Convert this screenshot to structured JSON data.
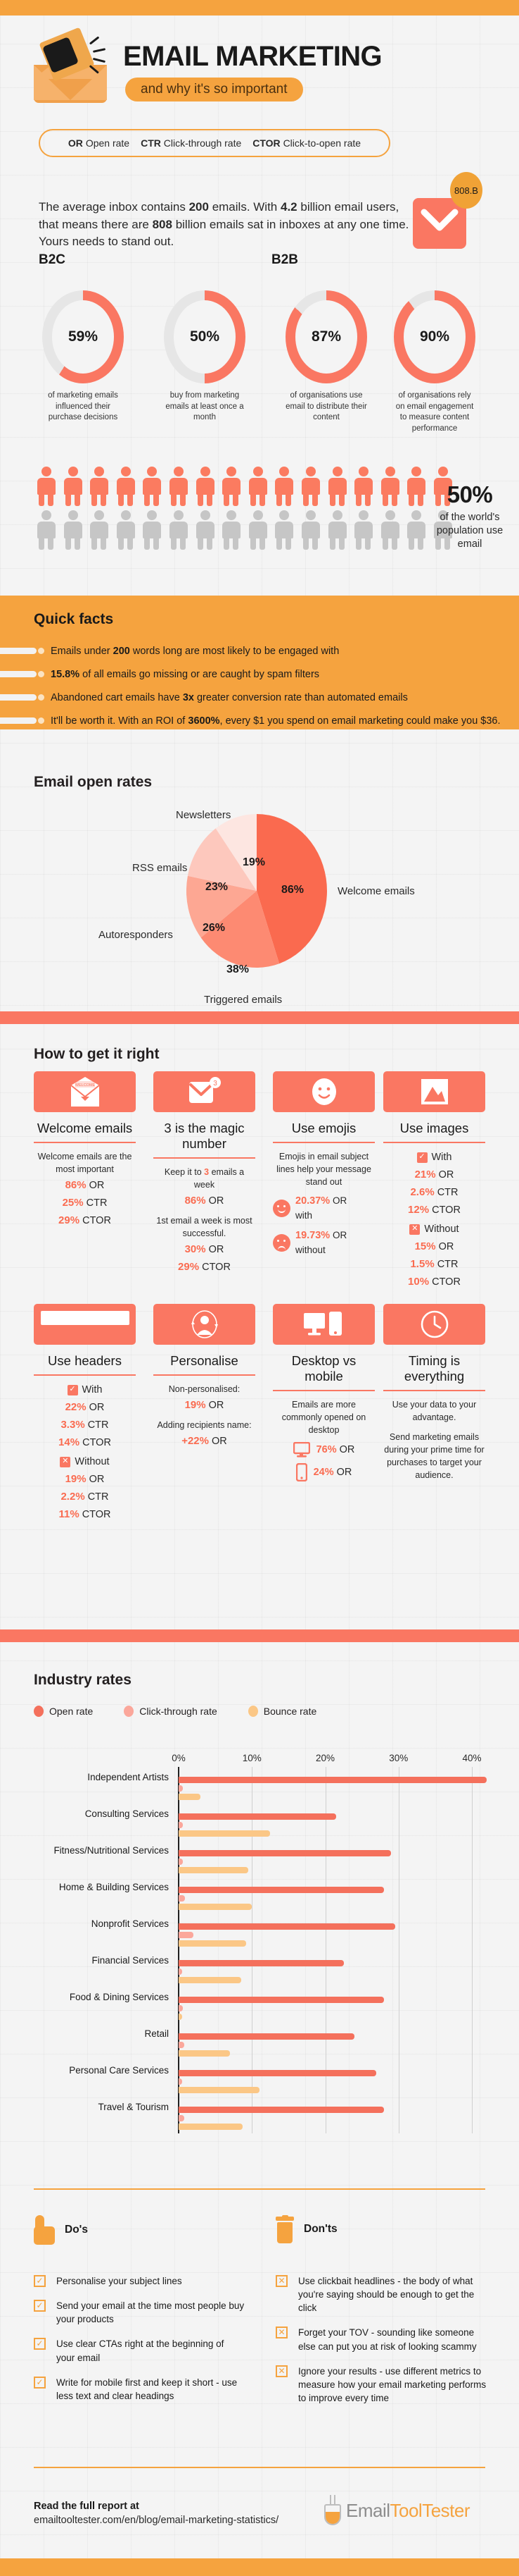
{
  "header": {
    "title": "EMAIL MARKETING",
    "subtitle": "and why it's so important",
    "logo_icon": "megaphone-envelope-icon"
  },
  "legend": [
    {
      "abbr": "OR",
      "full": "Open rate"
    },
    {
      "abbr": "CTR",
      "full": "Click-through rate"
    },
    {
      "abbr": "CTOR",
      "full": "Click-to-open rate"
    }
  ],
  "intro": {
    "part1": "The average inbox contains ",
    "n1": "200",
    "part2": " emails. With ",
    "n2": "4.2",
    "part3": " billion email users, that means there are ",
    "n3": "808",
    "part4": " billion emails sat in inboxes at any one time. Yours needs to stand out.",
    "badge": "808.B",
    "envelope_icon": "envelope-icon"
  },
  "segments": {
    "b2c_label": "B2C",
    "b2b_label": "B2B",
    "donuts": [
      {
        "value": "59%",
        "pct": 59,
        "caption": "of marketing emails influenced their purchase decisions"
      },
      {
        "value": "50%",
        "pct": 50,
        "caption": "buy from marketing emails at least once a month"
      },
      {
        "value": "87%",
        "pct": 87,
        "caption": "of organisations use email to distribute their content"
      },
      {
        "value": "90%",
        "pct": 90,
        "caption": "of organisations rely on email engagement to measure content performance"
      }
    ]
  },
  "population": {
    "stat": "50%",
    "caption": "of the world's population use email",
    "filled_icons": 16,
    "empty_icons": 16
  },
  "quick_facts": {
    "title": "Quick facts",
    "items": [
      {
        "pre": "Emails under ",
        "bold": "200",
        "post": " words long are most likely to be engaged with"
      },
      {
        "pre": "",
        "bold": "15.8%",
        "post": " of all emails go missing or are caught by spam filters"
      },
      {
        "pre": "Abandoned cart emails have ",
        "bold": "3x",
        "post": " greater conversion rate than automated emails"
      },
      {
        "pre": "It'll be worth it. With an ROI of ",
        "bold": "3600%",
        "post": ", every $1 you spend on email marketing could make you $36."
      }
    ]
  },
  "chart_data": [
    {
      "type": "pie",
      "title": "Email open rates",
      "labels": [
        "Welcome emails",
        "Triggered emails",
        "Autoresponders",
        "RSS emails",
        "Newsletters"
      ],
      "values": [
        86,
        38,
        26,
        23,
        19
      ],
      "value_labels": [
        "86%",
        "38%",
        "26%",
        "23%",
        "19%"
      ],
      "colors": [
        "#fa6a4f",
        "#fd8a72",
        "#fda793",
        "#fdc8bd",
        "#fde6e1"
      ],
      "legend": "inline-labels"
    },
    {
      "type": "bar",
      "orientation": "horizontal",
      "title": "Industry rates",
      "series": [
        {
          "name": "Open rate",
          "color": "#f4705c",
          "values": [
            42.0,
            21.5,
            29.0,
            28.0,
            29.5,
            22.5,
            28.0,
            24.0,
            27.0,
            28.0
          ]
        },
        {
          "name": "Click-through rate",
          "color": "#fba79b",
          "values": [
            0.6,
            0.6,
            0.6,
            0.9,
            2.0,
            0.5,
            0.6,
            0.8,
            0.5,
            0.8
          ]
        },
        {
          "name": "Bounce rate",
          "color": "#fbc786",
          "values": [
            3.0,
            12.5,
            9.5,
            10.0,
            9.2,
            8.5,
            0.5,
            7.0,
            11.0,
            8.7
          ]
        }
      ],
      "categories": [
        "Independent Artists",
        "Consulting Services",
        "Fitness/Nutritional Services",
        "Home & Building Services",
        "Nonprofit Services",
        "Financial Services",
        "Food & Dining Services",
        "Retail",
        "Personal Care Services",
        "Travel & Tourism"
      ],
      "xticks": [
        "0%",
        "10%",
        "20%",
        "30%",
        "40%"
      ],
      "xlim": [
        0,
        44
      ],
      "xlabel": "",
      "ylabel": "",
      "grid": true,
      "legend_position": "top-left"
    }
  ],
  "how_to": {
    "title": "How to get it right",
    "cards": [
      {
        "icon": "welcome-envelope-icon",
        "title": "Welcome emails",
        "body": "Welcome emails are the most important",
        "stats": [
          {
            "n": "86%",
            "k": "OR"
          },
          {
            "n": "25%",
            "k": "CTR"
          },
          {
            "n": "29%",
            "k": "CTOR"
          }
        ]
      },
      {
        "icon": "envelope-badge-3-icon",
        "title": "3 is the magic number",
        "body_pre": "Keep it to ",
        "body_num": "3",
        "body_post": " emails a week",
        "stats": [
          {
            "n": "86%",
            "k": "OR"
          }
        ],
        "note": "1st email a week is most successful.",
        "stats2": [
          {
            "n": "30%",
            "k": "OR"
          },
          {
            "n": "29%",
            "k": "CTOR"
          }
        ]
      },
      {
        "icon": "smiley-face-icon",
        "title": "Use emojis",
        "body": "Emojis in email subject lines help your message stand out",
        "emoji_stats": [
          {
            "face": "happy",
            "n": "20.37%",
            "k": "OR",
            "sub": "with"
          },
          {
            "face": "sad",
            "n": "19.73%",
            "k": "OR",
            "sub": "without"
          }
        ]
      },
      {
        "icon": "image-mountain-icon",
        "title": "Use images",
        "groups": [
          {
            "mark": "check",
            "label": "With",
            "stats": [
              {
                "n": "21%",
                "k": "OR"
              },
              {
                "n": "2.6%",
                "k": "CTR"
              },
              {
                "n": "12%",
                "k": "CTOR"
              }
            ]
          },
          {
            "mark": "cross",
            "label": "Without",
            "stats": [
              {
                "n": "15%",
                "k": "OR"
              },
              {
                "n": "1.5%",
                "k": "CTR"
              },
              {
                "n": "10%",
                "k": "CTOR"
              }
            ]
          }
        ]
      },
      {
        "icon": "header-bar-icon",
        "title": "Use headers",
        "groups": [
          {
            "mark": "check",
            "label": "With",
            "stats": [
              {
                "n": "22%",
                "k": "OR"
              },
              {
                "n": "3.3%",
                "k": "CTR"
              },
              {
                "n": "14%",
                "k": "CTOR"
              }
            ]
          },
          {
            "mark": "cross",
            "label": "Without",
            "stats": [
              {
                "n": "19%",
                "k": "OR"
              },
              {
                "n": "2.2%",
                "k": "CTR"
              },
              {
                "n": "11%",
                "k": "CTOR"
              }
            ]
          }
        ]
      },
      {
        "icon": "person-circle-icon",
        "title": "Personalise",
        "lines": [
          {
            "t": "Non-personalised:",
            "type": "text"
          },
          {
            "n": "19%",
            "k": "OR",
            "type": "stat"
          },
          {
            "t": "Adding recipients name:",
            "type": "text"
          },
          {
            "n": "+22%",
            "k": "OR",
            "type": "stat"
          }
        ]
      },
      {
        "icon": "desktop-mobile-icon",
        "title": "Desktop vs mobile",
        "body": "Emails are more commonly opened on desktop",
        "device_stats": [
          {
            "device": "desktop",
            "n": "76%",
            "k": "OR"
          },
          {
            "device": "mobile",
            "n": "24%",
            "k": "OR"
          }
        ]
      },
      {
        "icon": "clock-icon",
        "title": "Timing is everything",
        "body": "Use your data to your advantage.",
        "body2": "Send marketing emails during your prime time for purchases to target your audience."
      }
    ]
  },
  "dos_donts": {
    "dos_title": "Do's",
    "donts_title": "Don'ts",
    "dos_icon": "thumbs-up-icon",
    "donts_icon": "trash-can-icon",
    "dos": [
      "Personalise your subject lines",
      "Send your email at the time most people buy your products",
      "Use clear CTAs right at the beginning of your email",
      "Write for mobile first and keep it short - use less text and clear headings"
    ],
    "donts": [
      "Use clickbait headlines - the body of what you're saying should be enough to get the click",
      "Forget your TOV - sounding like someone else can put you at risk of looking scammy",
      "Ignore your results - use different metrics to measure how your email marketing performs to improve every time"
    ]
  },
  "footer": {
    "read_label": "Read the full report at",
    "url": "emailtooltester.com/en/blog/email-marketing-statistics/",
    "brand_part1": "Email",
    "brand_part2": "ToolTester",
    "brand_icon": "flask-icon"
  },
  "colors": {
    "orange": "#f5a33f",
    "coral": "#fa7762",
    "coral_dark": "#f4705c",
    "coral_light": "#fba79b",
    "peach": "#fbc786"
  }
}
